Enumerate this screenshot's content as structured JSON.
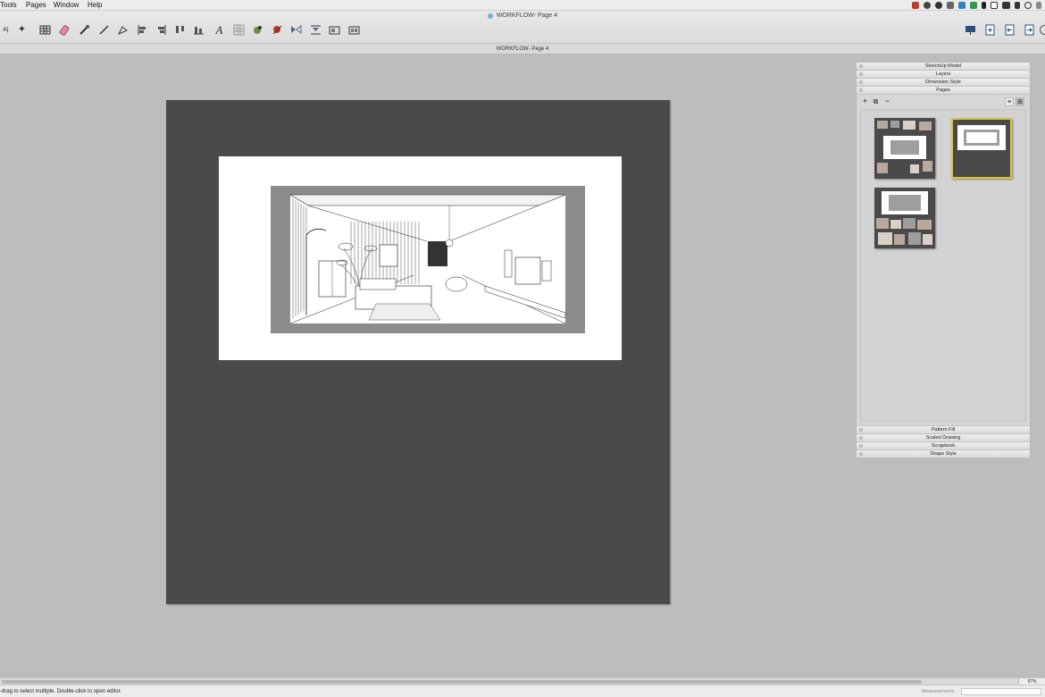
{
  "menubar": {
    "items": [
      "Tools",
      "Pages",
      "Window",
      "Help"
    ],
    "tray_icons": [
      "adobe-icon",
      "dropbox-icon",
      "creative-cloud-icon",
      "box-icon",
      "finder-icon",
      "battery-icon",
      "bluetooth-icon",
      "display-icon",
      "wifi-icon",
      "volume-icon",
      "search-icon",
      "menu-icon"
    ]
  },
  "window": {
    "title": "WORKFLOW- Page 4"
  },
  "toolbar": {
    "tools": [
      "select-tool-icon",
      "wand-tool-icon",
      "table-tool-icon",
      "eraser-tool-icon",
      "style-tool-icon",
      "pencil-tool-icon",
      "pen-tool-icon",
      "align-left-icon",
      "align-right-icon",
      "distribute-icon",
      "align-bottom-icon",
      "grid-icon",
      "text-tool-icon",
      "table-icon",
      "paint-icon",
      "split-icon",
      "flip-icon",
      "center-icon",
      "group-icon",
      "ungroup-icon"
    ],
    "right_tools": [
      "present-icon",
      "add-page-icon",
      "previous-page-icon",
      "next-page-icon",
      "help-icon"
    ]
  },
  "document": {
    "tab_title": "WORKFLOW- Page 4"
  },
  "tray": {
    "panels_top": [
      "SketchUp Model",
      "Layers",
      "Dimension Style",
      "Pages"
    ],
    "pages_toolbar": {
      "add": "+",
      "duplicate": "⧉",
      "delete": "−",
      "list_view": "≡",
      "thumb_view": "⊞"
    },
    "thumbnails": [
      {
        "label": "page-thumbnail-1",
        "selected": false
      },
      {
        "label": "page-thumbnail-2",
        "selected": true
      },
      {
        "label": "page-thumbnail-3",
        "selected": false
      }
    ],
    "panels_bottom": [
      "Pattern Fill",
      "Scaled Drawing",
      "Scrapbook",
      "Shape Style"
    ]
  },
  "status": {
    "text": "-drag to select multiple. Double-click to open editor.",
    "measurements_label": "Measurements",
    "zoom": "97%"
  }
}
